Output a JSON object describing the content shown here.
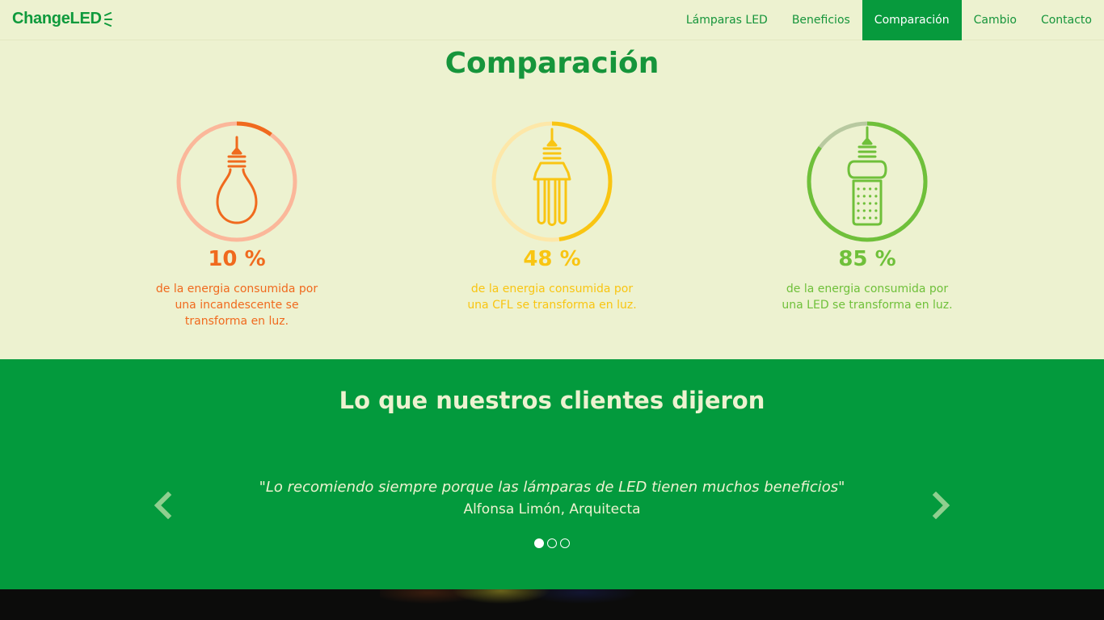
{
  "brand": {
    "name": "ChangeLED",
    "color": "#0f9a3c"
  },
  "nav": {
    "items": [
      {
        "label": "Lámparas LED",
        "active": false
      },
      {
        "label": "Beneficios",
        "active": false
      },
      {
        "label": "Comparación",
        "active": true
      },
      {
        "label": "Cambio",
        "active": false
      },
      {
        "label": "Contacto",
        "active": false
      }
    ]
  },
  "comparison": {
    "title": "Comparación",
    "cards": [
      {
        "icon": "incandescent-bulb-icon",
        "percent": 10,
        "percent_label": "10 %",
        "description": "de la energia consumida por una incandescente se transforma en luz.",
        "color": "#f06a1e",
        "track_color": "#fbb79a"
      },
      {
        "icon": "cfl-bulb-icon",
        "percent": 48,
        "percent_label": "48 %",
        "description": "de la energia consumida por una CFL se transforma en luz.",
        "color": "#f9c512",
        "track_color": "#fde7a8"
      },
      {
        "icon": "led-bulb-icon",
        "percent": 85,
        "percent_label": "85 %",
        "description": "de la energia consumida por una LED se transforma en luz.",
        "color": "#6fc03a",
        "track_color": "#b8c9a0"
      }
    ]
  },
  "testimonials": {
    "title": "Lo que nuestros clientes dijeron",
    "quote": "\"Lo recomiendo siempre porque las lámparas de LED tienen muchos beneficios\"",
    "author": "Alfonsa Limón, Arquitecta",
    "slides": 3,
    "active_slide": 0,
    "background": "#039a3d"
  }
}
